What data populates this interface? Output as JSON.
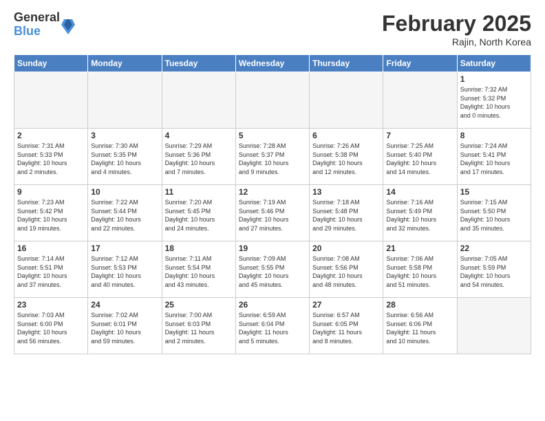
{
  "logo": {
    "general": "General",
    "blue": "Blue"
  },
  "header": {
    "month": "February 2025",
    "location": "Rajin, North Korea"
  },
  "weekdays": [
    "Sunday",
    "Monday",
    "Tuesday",
    "Wednesday",
    "Thursday",
    "Friday",
    "Saturday"
  ],
  "weeks": [
    [
      {
        "day": "",
        "info": ""
      },
      {
        "day": "",
        "info": ""
      },
      {
        "day": "",
        "info": ""
      },
      {
        "day": "",
        "info": ""
      },
      {
        "day": "",
        "info": ""
      },
      {
        "day": "",
        "info": ""
      },
      {
        "day": "1",
        "info": "Sunrise: 7:32 AM\nSunset: 5:32 PM\nDaylight: 10 hours\nand 0 minutes."
      }
    ],
    [
      {
        "day": "2",
        "info": "Sunrise: 7:31 AM\nSunset: 5:33 PM\nDaylight: 10 hours\nand 2 minutes."
      },
      {
        "day": "3",
        "info": "Sunrise: 7:30 AM\nSunset: 5:35 PM\nDaylight: 10 hours\nand 4 minutes."
      },
      {
        "day": "4",
        "info": "Sunrise: 7:29 AM\nSunset: 5:36 PM\nDaylight: 10 hours\nand 7 minutes."
      },
      {
        "day": "5",
        "info": "Sunrise: 7:28 AM\nSunset: 5:37 PM\nDaylight: 10 hours\nand 9 minutes."
      },
      {
        "day": "6",
        "info": "Sunrise: 7:26 AM\nSunset: 5:38 PM\nDaylight: 10 hours\nand 12 minutes."
      },
      {
        "day": "7",
        "info": "Sunrise: 7:25 AM\nSunset: 5:40 PM\nDaylight: 10 hours\nand 14 minutes."
      },
      {
        "day": "8",
        "info": "Sunrise: 7:24 AM\nSunset: 5:41 PM\nDaylight: 10 hours\nand 17 minutes."
      }
    ],
    [
      {
        "day": "9",
        "info": "Sunrise: 7:23 AM\nSunset: 5:42 PM\nDaylight: 10 hours\nand 19 minutes."
      },
      {
        "day": "10",
        "info": "Sunrise: 7:22 AM\nSunset: 5:44 PM\nDaylight: 10 hours\nand 22 minutes."
      },
      {
        "day": "11",
        "info": "Sunrise: 7:20 AM\nSunset: 5:45 PM\nDaylight: 10 hours\nand 24 minutes."
      },
      {
        "day": "12",
        "info": "Sunrise: 7:19 AM\nSunset: 5:46 PM\nDaylight: 10 hours\nand 27 minutes."
      },
      {
        "day": "13",
        "info": "Sunrise: 7:18 AM\nSunset: 5:48 PM\nDaylight: 10 hours\nand 29 minutes."
      },
      {
        "day": "14",
        "info": "Sunrise: 7:16 AM\nSunset: 5:49 PM\nDaylight: 10 hours\nand 32 minutes."
      },
      {
        "day": "15",
        "info": "Sunrise: 7:15 AM\nSunset: 5:50 PM\nDaylight: 10 hours\nand 35 minutes."
      }
    ],
    [
      {
        "day": "16",
        "info": "Sunrise: 7:14 AM\nSunset: 5:51 PM\nDaylight: 10 hours\nand 37 minutes."
      },
      {
        "day": "17",
        "info": "Sunrise: 7:12 AM\nSunset: 5:53 PM\nDaylight: 10 hours\nand 40 minutes."
      },
      {
        "day": "18",
        "info": "Sunrise: 7:11 AM\nSunset: 5:54 PM\nDaylight: 10 hours\nand 43 minutes."
      },
      {
        "day": "19",
        "info": "Sunrise: 7:09 AM\nSunset: 5:55 PM\nDaylight: 10 hours\nand 45 minutes."
      },
      {
        "day": "20",
        "info": "Sunrise: 7:08 AM\nSunset: 5:56 PM\nDaylight: 10 hours\nand 48 minutes."
      },
      {
        "day": "21",
        "info": "Sunrise: 7:06 AM\nSunset: 5:58 PM\nDaylight: 10 hours\nand 51 minutes."
      },
      {
        "day": "22",
        "info": "Sunrise: 7:05 AM\nSunset: 5:59 PM\nDaylight: 10 hours\nand 54 minutes."
      }
    ],
    [
      {
        "day": "23",
        "info": "Sunrise: 7:03 AM\nSunset: 6:00 PM\nDaylight: 10 hours\nand 56 minutes."
      },
      {
        "day": "24",
        "info": "Sunrise: 7:02 AM\nSunset: 6:01 PM\nDaylight: 10 hours\nand 59 minutes."
      },
      {
        "day": "25",
        "info": "Sunrise: 7:00 AM\nSunset: 6:03 PM\nDaylight: 11 hours\nand 2 minutes."
      },
      {
        "day": "26",
        "info": "Sunrise: 6:59 AM\nSunset: 6:04 PM\nDaylight: 11 hours\nand 5 minutes."
      },
      {
        "day": "27",
        "info": "Sunrise: 6:57 AM\nSunset: 6:05 PM\nDaylight: 11 hours\nand 8 minutes."
      },
      {
        "day": "28",
        "info": "Sunrise: 6:56 AM\nSunset: 6:06 PM\nDaylight: 11 hours\nand 10 minutes."
      },
      {
        "day": "",
        "info": ""
      }
    ]
  ]
}
